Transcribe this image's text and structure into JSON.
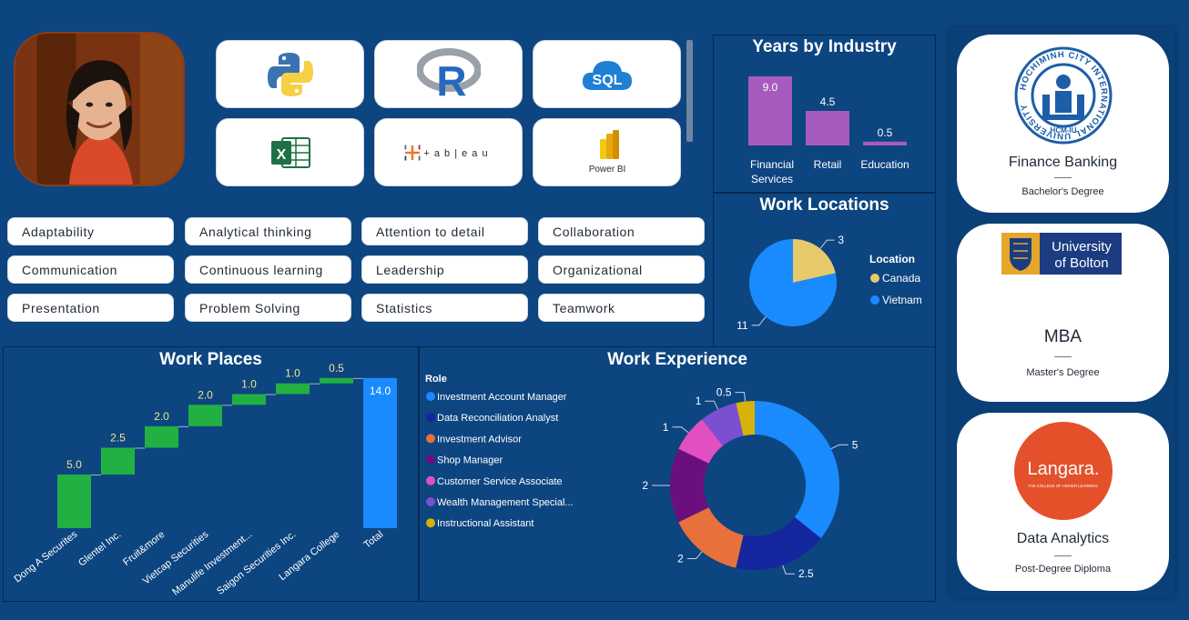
{
  "profile": {
    "photo_alt": ""
  },
  "tools": [
    {
      "name": "python-logo-icon",
      "label": ""
    },
    {
      "name": "r-logo-icon",
      "label": "R"
    },
    {
      "name": "sql-logo-icon",
      "label": "SQL"
    },
    {
      "name": "excel-logo-icon",
      "label": "X"
    },
    {
      "name": "tableau-logo-icon",
      "label": "+ a b | e a u"
    },
    {
      "name": "power-bi-logo-icon",
      "label": "Power BI"
    }
  ],
  "skills": [
    "Adaptability",
    "Analytical thinking",
    "Attention to detail",
    "Collaboration",
    "Communication",
    "Continuous learning",
    "Leadership",
    "Organizational",
    "Presentation",
    "Problem Solving",
    "Statistics",
    "Teamwork"
  ],
  "years_by_industry": {
    "title": "Years by Industry",
    "chart_data": {
      "type": "bar",
      "categories": [
        "Financial Services",
        "Retail",
        "Education"
      ],
      "category_lines": [
        [
          "Financial",
          "Services"
        ],
        [
          "Retail"
        ],
        [
          "Education"
        ]
      ],
      "values": [
        9.0,
        4.5,
        0.5
      ],
      "labels": [
        "9.0",
        "4.5",
        "0.5"
      ],
      "color": "#a65bbf"
    }
  },
  "work_locations": {
    "title": "Work Locations",
    "legend_title": "Location",
    "chart_data": {
      "type": "pie",
      "slices": [
        {
          "name": "Canada",
          "value": 3,
          "label": "3",
          "color": "#e8c96a"
        },
        {
          "name": "Vietnam",
          "value": 11,
          "label": "11",
          "color": "#1a8bff"
        }
      ]
    }
  },
  "work_places": {
    "title": "Work Places",
    "chart_data": {
      "type": "bar",
      "subtype": "waterfall",
      "categories": [
        "Dong A Securites",
        "Glentel Inc.",
        "Fruit&more",
        "Vietcap Securities",
        "Manulife Investment...",
        "Saigon Securities Inc.",
        "Langara College",
        "Total"
      ],
      "values": [
        5.0,
        2.5,
        2.0,
        2.0,
        1.0,
        1.0,
        0.5,
        14.0
      ],
      "labels": [
        "5.0",
        "2.5",
        "2.0",
        "2.0",
        "1.0",
        "1.0",
        "0.5",
        "14.0"
      ],
      "increase_color": "#22b043",
      "total_color": "#1a8bff"
    }
  },
  "work_experience": {
    "title": "Work Experience",
    "legend_title": "Role",
    "chart_data": {
      "type": "pie",
      "subtype": "donut",
      "slices": [
        {
          "name": "Investment Account Manager",
          "value": 5,
          "label": "5",
          "color": "#1a8bff"
        },
        {
          "name": "Data Reconciliation Analyst",
          "value": 2.5,
          "label": "2.5",
          "color": "#14269e"
        },
        {
          "name": "Investment Advisor",
          "value": 2,
          "label": "2",
          "color": "#e8703a"
        },
        {
          "name": "Shop Manager",
          "value": 2,
          "label": "2",
          "color": "#6c0f7e"
        },
        {
          "name": "Customer Service Associate",
          "value": 1,
          "label": "1",
          "color": "#e24fc0"
        },
        {
          "name": "Wealth Management Special...",
          "value": 1,
          "label": "1",
          "color": "#7a4fd0"
        },
        {
          "name": "Instructional Assistant",
          "value": 0.5,
          "label": "0.5",
          "color": "#d8b00a"
        }
      ]
    }
  },
  "education": [
    {
      "logo": "hcmiu-seal-icon",
      "logo_text_ring": "HOCHIMINH CITY INTERNATIONAL UNIVERSITY",
      "logo_text_bottom": "HCM-IU",
      "name": "Finance Banking",
      "degree": "Bachelor's Degree"
    },
    {
      "logo": "bolton-logo-icon",
      "logo_text_1": "University",
      "logo_text_2": "of Bolton",
      "name": "MBA",
      "degree": "Master's Degree"
    },
    {
      "logo": "langara-logo-icon",
      "logo_text_1": "Langara.",
      "logo_text_2": "THE COLLEGE OF HIGHER LEARNING.",
      "name": "Data Analytics",
      "degree": "Post-Degree Diploma"
    }
  ],
  "colors": {
    "background": "#0c4580",
    "panel_border": "#06294f",
    "card": "#ffffff"
  }
}
